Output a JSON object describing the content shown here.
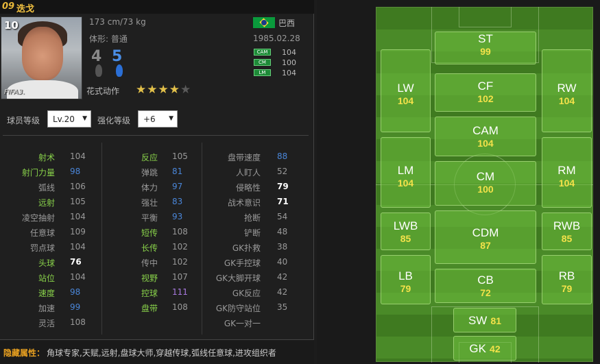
{
  "player": {
    "number": "09",
    "name": "迭戈",
    "rating": "10",
    "watermark": "FIFA3.",
    "height_weight": "173 cm/73 kg",
    "body_type": "体形: 普通",
    "nation": "巴西",
    "dob": "1985.02.28",
    "foot_left": "4",
    "foot_right": "5",
    "positions": [
      {
        "tag": "CAM",
        "value": "104"
      },
      {
        "tag": "CM",
        "value": "100"
      },
      {
        "tag": "LM",
        "value": "104"
      }
    ],
    "skill_label": "花式动作",
    "skill_stars": 4,
    "skill_stars_max": 5
  },
  "controls": {
    "level_label": "球员等级",
    "level_value": "Lv.20",
    "enhance_label": "强化等级",
    "enhance_value": "+6"
  },
  "colors": {
    "highlight_green": "#88d14a",
    "white": "#ffffff",
    "grey": "#9a9a9a",
    "blue": "#4a86d9",
    "purple": "#a97ae0",
    "gold": "#f4e24a"
  },
  "stats": {
    "col1": [
      {
        "name": "射术",
        "value": "104",
        "name_color": "highlight_green",
        "value_color": "grey"
      },
      {
        "name": "射门力量",
        "value": "98",
        "name_color": "highlight_green",
        "value_color": "blue"
      },
      {
        "name": "弧线",
        "value": "106",
        "name_color": "grey",
        "value_color": "grey"
      },
      {
        "name": "远射",
        "value": "105",
        "name_color": "highlight_green",
        "value_color": "grey"
      },
      {
        "name": "凌空抽射",
        "value": "104",
        "name_color": "grey",
        "value_color": "grey"
      },
      {
        "name": "任意球",
        "value": "109",
        "name_color": "grey",
        "value_color": "grey"
      },
      {
        "name": "罚点球",
        "value": "104",
        "name_color": "grey",
        "value_color": "grey"
      },
      {
        "name": "头球",
        "value": "76",
        "name_color": "highlight_green",
        "value_color": "white"
      },
      {
        "name": "站位",
        "value": "104",
        "name_color": "highlight_green",
        "value_color": "grey"
      },
      {
        "name": "速度",
        "value": "98",
        "name_color": "highlight_green",
        "value_color": "blue"
      },
      {
        "name": "加速",
        "value": "99",
        "name_color": "grey",
        "value_color": "blue"
      },
      {
        "name": "灵活",
        "value": "108",
        "name_color": "grey",
        "value_color": "grey"
      }
    ],
    "col2": [
      {
        "name": "反应",
        "value": "105",
        "name_color": "highlight_green",
        "value_color": "grey"
      },
      {
        "name": "弹跳",
        "value": "81",
        "name_color": "grey",
        "value_color": "blue"
      },
      {
        "name": "体力",
        "value": "97",
        "name_color": "grey",
        "value_color": "blue"
      },
      {
        "name": "强壮",
        "value": "83",
        "name_color": "grey",
        "value_color": "blue"
      },
      {
        "name": "平衡",
        "value": "93",
        "name_color": "grey",
        "value_color": "blue"
      },
      {
        "name": "短传",
        "value": "108",
        "name_color": "highlight_green",
        "value_color": "grey"
      },
      {
        "name": "长传",
        "value": "102",
        "name_color": "highlight_green",
        "value_color": "grey"
      },
      {
        "name": "传中",
        "value": "102",
        "name_color": "grey",
        "value_color": "grey"
      },
      {
        "name": "视野",
        "value": "107",
        "name_color": "highlight_green",
        "value_color": "grey"
      },
      {
        "name": "控球",
        "value": "111",
        "name_color": "highlight_green",
        "value_color": "purple"
      },
      {
        "name": "盘带",
        "value": "108",
        "name_color": "highlight_green",
        "value_color": "grey"
      }
    ],
    "col3": [
      {
        "name": "盘带速度",
        "value": "88",
        "name_color": "grey",
        "value_color": "blue"
      },
      {
        "name": "人盯人",
        "value": "52",
        "name_color": "grey",
        "value_color": "grey"
      },
      {
        "name": "侵略性",
        "value": "79",
        "name_color": "grey",
        "value_color": "white"
      },
      {
        "name": "战术意识",
        "value": "71",
        "name_color": "grey",
        "value_color": "white"
      },
      {
        "name": "抢断",
        "value": "54",
        "name_color": "grey",
        "value_color": "grey"
      },
      {
        "name": "铲断",
        "value": "48",
        "name_color": "grey",
        "value_color": "grey"
      },
      {
        "name": "GK扑救",
        "value": "38",
        "name_color": "grey",
        "value_color": "grey"
      },
      {
        "name": "GK手控球",
        "value": "40",
        "name_color": "grey",
        "value_color": "grey"
      },
      {
        "name": "GK大脚开球",
        "value": "42",
        "name_color": "grey",
        "value_color": "grey"
      },
      {
        "name": "GK反应",
        "value": "42",
        "name_color": "grey",
        "value_color": "grey"
      },
      {
        "name": "GK防守站位",
        "value": "35",
        "name_color": "grey",
        "value_color": "grey"
      },
      {
        "name": "GK一对一",
        "value": "",
        "name_color": "grey",
        "value_color": "grey"
      }
    ]
  },
  "hidden": {
    "label": "隐藏属性：",
    "value": "角球专家,天赋,远射,盘球大师,穿越传球,弧线任意球,进攻组织者"
  },
  "pitch": {
    "positions": {
      "ST": "99",
      "LW": "104",
      "CF": "102",
      "RW": "104",
      "CAM": "104",
      "LM": "104",
      "CM": "100",
      "RM": "104",
      "LWB": "85",
      "CDM": "87",
      "RWB": "85",
      "LB": "79",
      "CB": "72",
      "RB": "79",
      "SW": "81",
      "GK": "42"
    }
  }
}
